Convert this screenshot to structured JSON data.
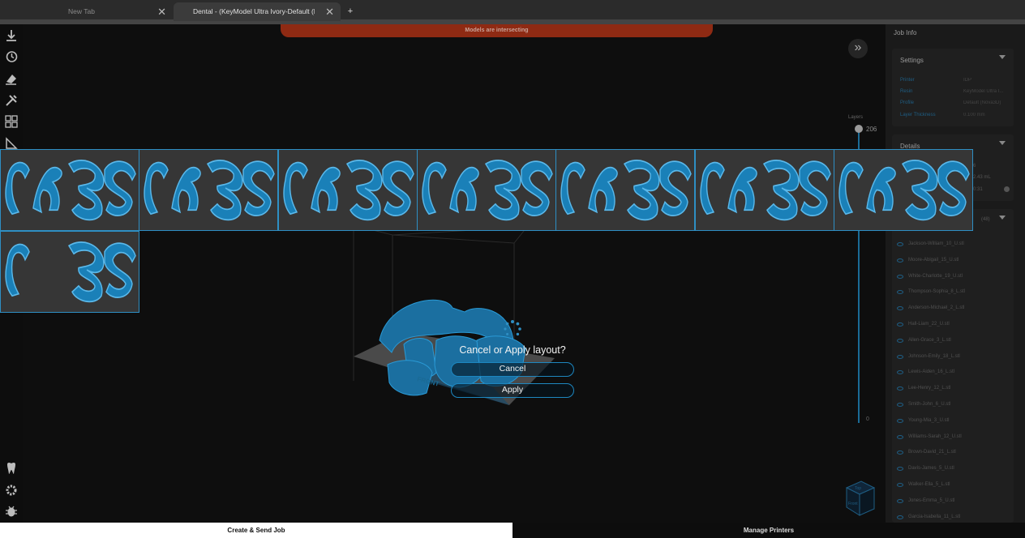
{
  "tabs": [
    {
      "label": "New Tab",
      "active": false
    },
    {
      "label": "Dental - (KeyModel Ultra Ivory-Default (N",
      "active": true
    }
  ],
  "new_tab_label": "+",
  "warning": "Models are intersecting",
  "slider": {
    "label": "Layers",
    "top_value": "206",
    "bottom_value": "0"
  },
  "right_panel": {
    "header": "Job Info",
    "settings": {
      "title": "Settings",
      "rows": [
        {
          "key": "Printer",
          "value": "IDP"
        },
        {
          "key": "Resin",
          "value": "KeyModel Ultra I..."
        },
        {
          "key": "Profile",
          "value": "Default (Nova3D)"
        },
        {
          "key": "Layer Thickness",
          "value": "0.100 mm"
        }
      ]
    },
    "details": {
      "title": "Details",
      "values": [
        "6",
        "2.43 mL",
        "0:31"
      ]
    },
    "models": {
      "count": "(48)",
      "files": [
        "Jackson-William_10_U.stl",
        "Moore-Abigail_15_U.stl",
        "White-Charlotte_19_U.stl",
        "Thompson-Sophia_8_L.stl",
        "Anderson-Michael_2_L.stl",
        "Hall-Liam_22_U.stl",
        "Allen-Grace_3_L.stl",
        "Johnson-Emily_18_L.stl",
        "Lewis-Aiden_16_L.stl",
        "Lee-Henry_12_L.stl",
        "Smith-John_6_U.stl",
        "Young-Mia_3_U.stl",
        "Williams-Sarah_12_U.stl",
        "Brown-David_21_L.stl",
        "Davis-James_5_U.stl",
        "Walker-Ella_5_L.stl",
        "Jones-Emma_5_U.stl",
        "Garcia-Isabella_11_L.stl"
      ]
    }
  },
  "dialog": {
    "title": "Cancel or Apply layout?",
    "cancel": "Cancel",
    "apply": "Apply"
  },
  "bottom": {
    "create": "Create & Send Job",
    "manage": "Manage Printers"
  },
  "build_plate_label": "FRONT",
  "view_cube": {
    "top": "Top",
    "front": "Front"
  },
  "colors": {
    "accent": "#2e8fc4",
    "model": "#1a80b8",
    "warning": "#8e2a13"
  }
}
